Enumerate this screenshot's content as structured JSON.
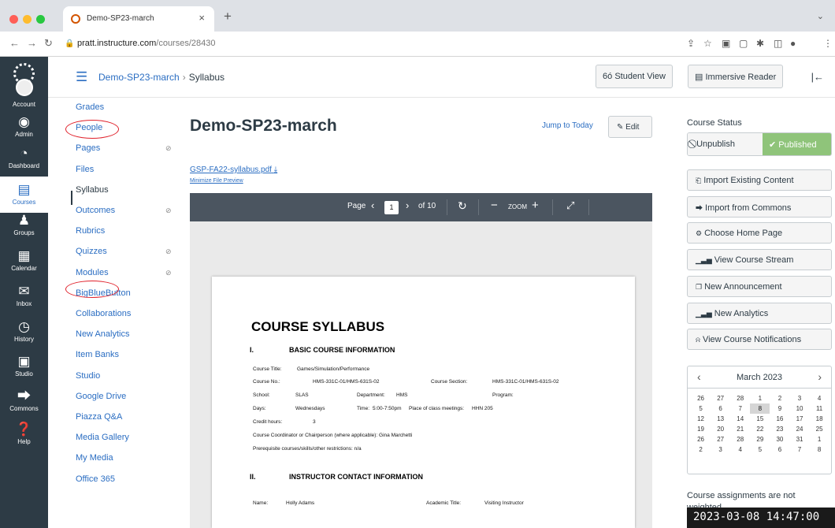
{
  "browser": {
    "tab_title": "Demo-SP23-march",
    "url_host": "pratt.instructure.com",
    "url_path": "/courses/28430"
  },
  "global_nav": [
    {
      "label": "Account",
      "icon": "account-avatar-icon",
      "glyph": ""
    },
    {
      "label": "Admin",
      "icon": "admin-shield-icon",
      "glyph": "◉"
    },
    {
      "label": "Dashboard",
      "icon": "dashboard-icon",
      "glyph": "◔"
    },
    {
      "label": "Courses",
      "icon": "courses-book-icon",
      "glyph": "▤"
    },
    {
      "label": "Groups",
      "icon": "groups-people-icon",
      "glyph": "♟"
    },
    {
      "label": "Calendar",
      "icon": "calendar-icon",
      "glyph": "▦"
    },
    {
      "label": "Inbox",
      "icon": "inbox-icon",
      "glyph": "✉"
    },
    {
      "label": "History",
      "icon": "history-clock-icon",
      "glyph": "◷"
    },
    {
      "label": "Studio",
      "icon": "studio-screen-icon",
      "glyph": "▣"
    },
    {
      "label": "Commons",
      "icon": "commons-arrow-icon",
      "glyph": "⮕"
    },
    {
      "label": "Help",
      "icon": "help-icon",
      "glyph": "❓"
    }
  ],
  "header": {
    "course": "Demo-SP23-march",
    "separator": "›",
    "page": "Syllabus",
    "student_view": "Student View",
    "immersive_reader": "Immersive Reader"
  },
  "course_nav": [
    {
      "label": "Grades",
      "hidden": false
    },
    {
      "label": "People",
      "hidden": false
    },
    {
      "label": "Pages",
      "hidden": true
    },
    {
      "label": "Files",
      "hidden": false
    },
    {
      "label": "Syllabus",
      "hidden": false
    },
    {
      "label": "Outcomes",
      "hidden": true
    },
    {
      "label": "Rubrics",
      "hidden": false
    },
    {
      "label": "Quizzes",
      "hidden": true
    },
    {
      "label": "Modules",
      "hidden": true
    },
    {
      "label": "BigBlueButton",
      "hidden": false
    },
    {
      "label": "Collaborations",
      "hidden": false
    },
    {
      "label": "New Analytics",
      "hidden": false
    },
    {
      "label": "Item Banks",
      "hidden": false
    },
    {
      "label": "Studio",
      "hidden": false
    },
    {
      "label": "Google Drive",
      "hidden": false
    },
    {
      "label": "Piazza Q&A",
      "hidden": false
    },
    {
      "label": "Media Gallery",
      "hidden": false
    },
    {
      "label": "My Media",
      "hidden": false
    },
    {
      "label": "Office 365",
      "hidden": false
    }
  ],
  "main": {
    "title": "Demo-SP23-march",
    "jump_to_today": "Jump to Today",
    "edit": "Edit",
    "file_link": "GSP-FA22-syllabus.pdf",
    "minimize_link": "Minimize File Preview"
  },
  "viewer": {
    "page_label": "Page",
    "current_page": "1",
    "of_pages": "of 10",
    "zoom_label": "ZOOM"
  },
  "pdf": {
    "heading": "COURSE SYLLABUS",
    "section1_num": "I.",
    "section1_title": "BASIC COURSE INFORMATION",
    "course_title_label": "Course Title:",
    "course_title": "Games/Simulation/Performance",
    "course_no_label": "Course No.:",
    "course_no": "HMS-331C-01/HMS-631S-02",
    "course_section_label": "Course Section:",
    "course_section": "HMS-331C-01/HMS-631S-02",
    "school_label": "School:",
    "school": "SLAS",
    "department_label": "Department:",
    "department": "HMS",
    "program_label": "Program:",
    "days_label": "Days:",
    "days": "Wednesdays",
    "time_label": "Time:",
    "time": "5:00-7:50pm",
    "place_label": "Place of class meetings:",
    "place": "HHN 205",
    "credit_label": "Credit hours:",
    "credit": "3",
    "coordinator": "Course Coordinator or Chairperson (where applicable): Gina Marchetti",
    "prereq": "Prerequisite courses/skills/other restrictions: n/a",
    "section2_num": "II.",
    "section2_title": "INSTRUCTOR CONTACT INFORMATION",
    "name_label": "Name:",
    "name": "Holly Adams",
    "academic_title_label": "Academic Title:",
    "academic_title": "Visiting Instructor"
  },
  "sidebar": {
    "course_status": "Course Status",
    "unpublish": "Unpublish",
    "published": "Published",
    "buttons": [
      {
        "label": "Import Existing Content",
        "icon": "import-icon",
        "glyph": "⎗"
      },
      {
        "label": "Import from Commons",
        "icon": "commons-icon",
        "glyph": "⮕"
      },
      {
        "label": "Choose Home Page",
        "icon": "home-gear-icon",
        "glyph": "⚙"
      },
      {
        "label": "View Course Stream",
        "icon": "stream-bars-icon",
        "glyph": "▁▃▅"
      },
      {
        "label": "New Announcement",
        "icon": "announcement-icon",
        "glyph": "❐"
      },
      {
        "label": "New Analytics",
        "icon": "analytics-bars-icon",
        "glyph": "▁▃▅"
      },
      {
        "label": "View Course Notifications",
        "icon": "bell-icon",
        "glyph": "⍾"
      }
    ],
    "assignments_note": "Course assignments are not weighted."
  },
  "calendar": {
    "title": "March 2023",
    "today": "8",
    "weeks": [
      [
        "26",
        "27",
        "28",
        "1",
        "2",
        "3",
        "4"
      ],
      [
        "5",
        "6",
        "7",
        "8",
        "9",
        "10",
        "11"
      ],
      [
        "12",
        "13",
        "14",
        "15",
        "16",
        "17",
        "18"
      ],
      [
        "19",
        "20",
        "21",
        "22",
        "23",
        "24",
        "25"
      ],
      [
        "26",
        "27",
        "28",
        "29",
        "30",
        "31",
        "1"
      ],
      [
        "2",
        "3",
        "4",
        "5",
        "6",
        "7",
        "8"
      ]
    ]
  },
  "overlay": {
    "timestamp": "2023-03-08 14:47:00"
  },
  "colors": {
    "canvas_nav": "#2d3b45",
    "link": "#2a6dc2",
    "published": "#8fc47a",
    "annotation_circle": "#e0202a"
  }
}
